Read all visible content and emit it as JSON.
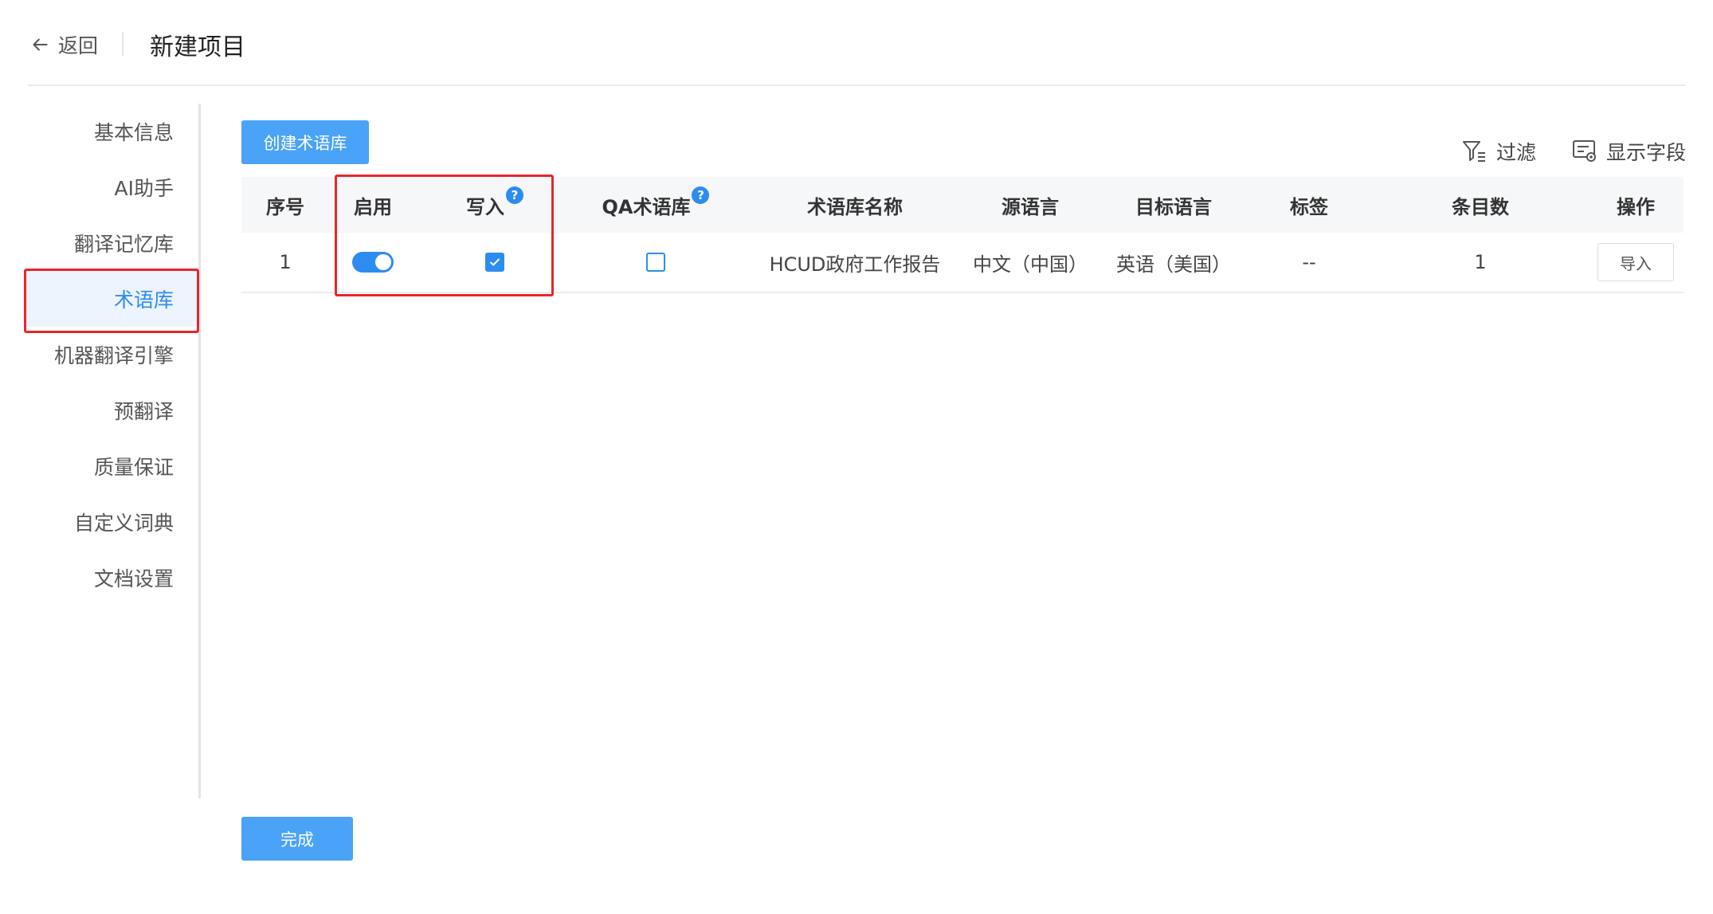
{
  "header": {
    "back_label": "返回",
    "title": "新建项目"
  },
  "sidebar": {
    "items": [
      {
        "label": "基本信息"
      },
      {
        "label": "AI助手"
      },
      {
        "label": "翻译记忆库"
      },
      {
        "label": "术语库"
      },
      {
        "label": "机器翻译引擎"
      },
      {
        "label": "预翻译"
      },
      {
        "label": "质量保证"
      },
      {
        "label": "自定义词典"
      },
      {
        "label": "文档设置"
      }
    ],
    "active": "术语库"
  },
  "toolbar": {
    "create_label": "创建术语库",
    "filter_label": "过滤",
    "fields_label": "显示字段"
  },
  "table": {
    "columns": {
      "index": "序号",
      "enable": "启用",
      "write": "写入",
      "qa": "QA术语库",
      "name": "术语库名称",
      "source": "源语言",
      "target": "目标语言",
      "tags": "标签",
      "count": "条目数",
      "actions": "操作"
    },
    "help_mark": "?",
    "rows": [
      {
        "index": "1",
        "enabled": true,
        "write": true,
        "qa": false,
        "name": "HCUD政府工作报告",
        "source": "中文（中国）",
        "target": "英语（美国）",
        "tags": "--",
        "count": "1",
        "action_label": "导入"
      }
    ]
  },
  "footer": {
    "done_label": "完成"
  },
  "colors": {
    "primary": "#2d8cf0",
    "button": "#4aa3f7",
    "highlight": "#e8262c",
    "active_bg": "#eef4fe"
  }
}
